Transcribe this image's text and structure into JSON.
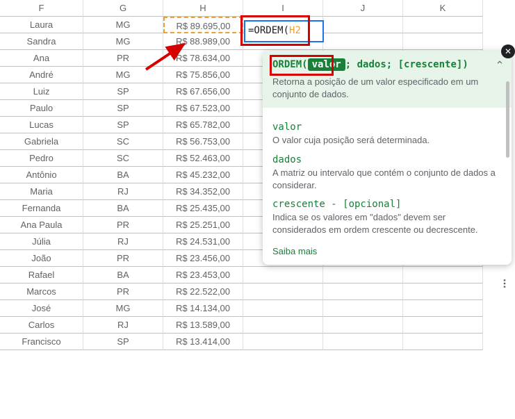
{
  "columns": [
    "F",
    "G",
    "H",
    "I",
    "J",
    "K"
  ],
  "rows": [
    {
      "f": "Laura",
      "g": "MG",
      "h": "R$ 89.695,00"
    },
    {
      "f": "Sandra",
      "g": "MG",
      "h": "R$ 88.989,00"
    },
    {
      "f": "Ana",
      "g": "PR",
      "h": "R$ 78.634,00"
    },
    {
      "f": "André",
      "g": "MG",
      "h": "R$ 75.856,00"
    },
    {
      "f": "Luiz",
      "g": "SP",
      "h": "R$ 67.656,00"
    },
    {
      "f": "Paulo",
      "g": "SP",
      "h": "R$ 67.523,00"
    },
    {
      "f": "Lucas",
      "g": "SP",
      "h": "R$ 65.782,00"
    },
    {
      "f": "Gabriela",
      "g": "SC",
      "h": "R$ 56.753,00"
    },
    {
      "f": "Pedro",
      "g": "SC",
      "h": "R$ 52.463,00"
    },
    {
      "f": "Antônio",
      "g": "BA",
      "h": "R$ 45.232,00"
    },
    {
      "f": "Maria",
      "g": "RJ",
      "h": "R$ 34.352,00"
    },
    {
      "f": "Fernanda",
      "g": "BA",
      "h": "R$ 25.435,00"
    },
    {
      "f": "Ana Paula",
      "g": "PR",
      "h": "R$ 25.251,00"
    },
    {
      "f": "Júlia",
      "g": "RJ",
      "h": "R$ 24.531,00"
    },
    {
      "f": "João",
      "g": "PR",
      "h": "R$ 23.456,00"
    },
    {
      "f": "Rafael",
      "g": "BA",
      "h": "R$ 23.453,00"
    },
    {
      "f": "Marcos",
      "g": "PR",
      "h": "R$ 22.522,00"
    },
    {
      "f": "José",
      "g": "MG",
      "h": "R$ 14.134,00"
    },
    {
      "f": "Carlos",
      "g": "RJ",
      "h": "R$ 13.589,00"
    },
    {
      "f": "Francisco",
      "g": "SP",
      "h": "R$ 13.414,00"
    }
  ],
  "formula": {
    "prefix": "=ORDEM(",
    "arg": "H2",
    "suffix": ""
  },
  "tooltip": {
    "fn": "ORDEM",
    "sig_open": "(",
    "sig_valor": "valor",
    "sig_rest": "; dados; [crescente])",
    "desc": "Retorna a posição de um valor especificado em um conjunto de dados.",
    "params": [
      {
        "name": "valor",
        "desc": "O valor cuja posição será determinada."
      },
      {
        "name": "dados",
        "desc": "A matriz ou intervalo que contém o conjunto de dados a considerar."
      },
      {
        "name": "crescente - [opcional]",
        "desc": "Indica se os valores em \"dados\" devem ser considerados em ordem crescente ou decrescente."
      }
    ],
    "link": "Saiba mais"
  }
}
